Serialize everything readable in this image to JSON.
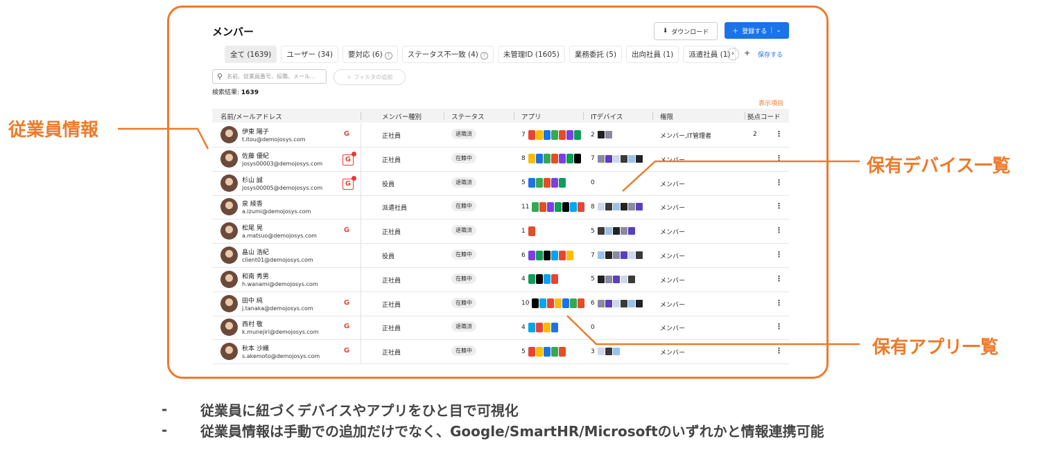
{
  "page": {
    "title": "メンバー"
  },
  "toolbar": {
    "download_label": "ダウンロード",
    "register_label": "登録する"
  },
  "tabs": [
    {
      "label": "全て (1639)",
      "active": true
    },
    {
      "label": "ユーザー (34)"
    },
    {
      "label": "要対応 (6)",
      "help": true
    },
    {
      "label": "ステータス不一致 (4)",
      "help": true
    },
    {
      "label": "未管理ID (1605)"
    },
    {
      "label": "業務委託 (5)"
    },
    {
      "label": "出向社員 (1)"
    },
    {
      "label": "派遣社員 (1)"
    }
  ],
  "tab_actions": {
    "next_icon": "›",
    "add_icon": "+",
    "save_label": "保存する"
  },
  "search": {
    "placeholder": "名前、従業員番号、役職、メール…",
    "filter_label": "＋ フィルタの追加"
  },
  "result": {
    "label": "検索結果:",
    "count": "1639"
  },
  "display_items_label": "表示項目",
  "columns": {
    "name": "名前/メールアドレス",
    "type": "メンバー種別",
    "status": "ステータス",
    "apps": "アプリ",
    "devices": "ITデバイス",
    "role": "権限",
    "kyoten": "拠点コード"
  },
  "rows": [
    {
      "name": "伊東 陽子",
      "email": "t.itou@demojosys.com",
      "g": "G",
      "g_alert": false,
      "type": "正社員",
      "status": "退職済",
      "apps": "7",
      "devices": "2",
      "role": "メンバー,IT管理者",
      "kyoten": "2"
    },
    {
      "name": "佐藤 優紀",
      "email": "josys00003@demojosys.com",
      "g": "G",
      "g_alert": true,
      "type": "正社員",
      "status": "在籍中",
      "apps": "8",
      "devices": "7",
      "role": "メンバー",
      "kyoten": ""
    },
    {
      "name": "杉山 誠",
      "email": "josys00005@demojosys.com",
      "g": "G",
      "g_alert": true,
      "type": "役員",
      "status": "退職済",
      "apps": "5",
      "devices": "0",
      "role": "メンバー",
      "kyoten": ""
    },
    {
      "name": "泉 綾香",
      "email": "a.izumi@demojosys.com",
      "g": "",
      "g_alert": false,
      "type": "派遣社員",
      "status": "在籍中",
      "apps": "11",
      "devices": "8",
      "role": "メンバー",
      "kyoten": ""
    },
    {
      "name": "松尾 晃",
      "email": "a.matsuo@demojosys.com",
      "g": "G",
      "g_alert": false,
      "type": "正社員",
      "status": "退職済",
      "apps": "1",
      "devices": "5",
      "role": "メンバー",
      "kyoten": ""
    },
    {
      "name": "畠山 浩紀",
      "email": "client01@demojosys.com",
      "g": "",
      "g_alert": false,
      "type": "役員",
      "status": "在籍中",
      "apps": "6",
      "devices": "7",
      "role": "メンバー",
      "kyoten": ""
    },
    {
      "name": "和南 秀男",
      "email": "h.wanami@demojosys.com",
      "g": "",
      "g_alert": false,
      "type": "正社員",
      "status": "在籍中",
      "apps": "4",
      "devices": "5",
      "role": "メンバー",
      "kyoten": ""
    },
    {
      "name": "田中 純",
      "email": "j.tanaka@demojosys.com",
      "g": "G",
      "g_alert": false,
      "type": "正社員",
      "status": "在籍中",
      "apps": "10",
      "devices": "6",
      "role": "メンバー",
      "kyoten": ""
    },
    {
      "name": "西村 敬",
      "email": "k.munejiri@demojosys.com",
      "g": "G",
      "g_alert": false,
      "type": "正社員",
      "status": "退職済",
      "apps": "4",
      "devices": "0",
      "role": "メンバー",
      "kyoten": ""
    },
    {
      "name": "秋本 沙織",
      "email": "s.akemoto@demojosys.com",
      "g": "G",
      "g_alert": false,
      "type": "正社員",
      "status": "在籍中",
      "apps": "5",
      "devices": "3",
      "role": "メンバー",
      "kyoten": ""
    }
  ],
  "colors": {
    "accent": "#ee7a2a",
    "primary": "#1a73e8"
  },
  "callouts": {
    "employee_info": "従業員情報",
    "device_list": "保有デバイス一覧",
    "app_list": "保有アプリ一覧"
  },
  "bullets": [
    {
      "dash": "-",
      "text": "従業員に紐づくデバイスやアプリをひと目で可視化"
    },
    {
      "dash": "-",
      "text": "従業員情報は手動での追加だけでなく、Google/SmartHR/Microsoftのいずれかと情報連携可能"
    }
  ]
}
